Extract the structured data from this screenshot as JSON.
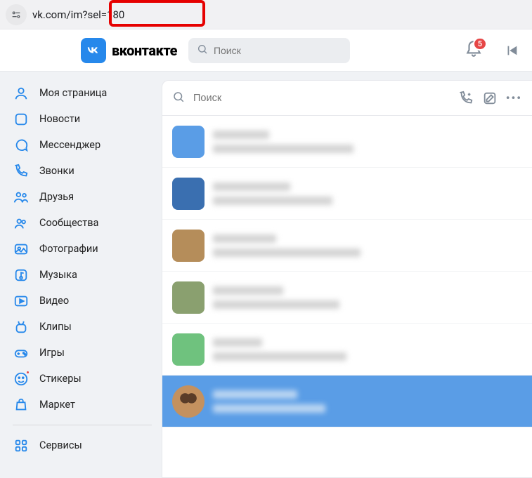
{
  "address_bar": {
    "url": "vk.com/im?sel=180"
  },
  "header": {
    "brand": "вконтакте",
    "search_placeholder": "Поиск",
    "notifications_count": "5"
  },
  "sidebar": {
    "items": [
      {
        "label": "Моя страница"
      },
      {
        "label": "Новости"
      },
      {
        "label": "Мессенджер"
      },
      {
        "label": "Звонки"
      },
      {
        "label": "Друзья"
      },
      {
        "label": "Сообщества"
      },
      {
        "label": "Фотографии"
      },
      {
        "label": "Музыка"
      },
      {
        "label": "Видео"
      },
      {
        "label": "Клипы"
      },
      {
        "label": "Игры"
      },
      {
        "label": "Стикеры"
      },
      {
        "label": "Маркет"
      }
    ],
    "services_label": "Сервисы"
  },
  "im": {
    "search_placeholder": "Поиск",
    "chats": [
      {
        "avatar_color": "#5a9de6"
      },
      {
        "avatar_color": "#3a6fb0"
      },
      {
        "avatar_color": "#b58d5a"
      },
      {
        "avatar_color": "#8aa06f"
      },
      {
        "avatar_color": "#6fc27e"
      },
      {
        "selected": true
      }
    ]
  }
}
